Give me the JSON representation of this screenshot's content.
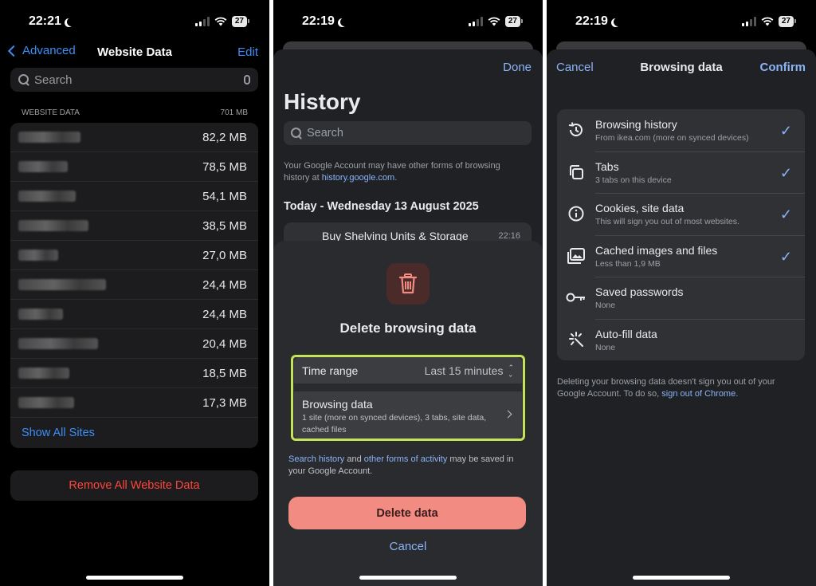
{
  "status": {
    "time1": "22:21",
    "time2": "22:19",
    "time3": "22:19",
    "battery": "27"
  },
  "panel1": {
    "back_label": "Advanced",
    "title": "Website Data",
    "edit_label": "Edit",
    "search_placeholder": "Search",
    "section_label": "WEBSITE DATA",
    "section_total": "701 MB",
    "rows": [
      {
        "size": "82,2 MB"
      },
      {
        "size": "78,5 MB"
      },
      {
        "size": "54,1 MB"
      },
      {
        "size": "38,5 MB"
      },
      {
        "size": "27,0 MB"
      },
      {
        "size": "24,4 MB"
      },
      {
        "size": "24,4 MB"
      },
      {
        "size": "20,4 MB"
      },
      {
        "size": "18,5 MB"
      },
      {
        "size": "17,3 MB"
      }
    ],
    "show_all": "Show All Sites",
    "remove_all": "Remove All Website Data"
  },
  "panel2": {
    "done_label": "Done",
    "title": "History",
    "search_placeholder": "Search",
    "note_text": "Your Google Account may have other forms of browsing history at ",
    "note_link": "history.google.com",
    "note_end": ".",
    "day_header": "Today - Wednesday 13 August 2025",
    "peek_title": "Buy Shelving Units & Storage",
    "peek_time": "22:16",
    "dialog_title": "Delete browsing data",
    "time_range_label": "Time range",
    "time_range_value": "Last 15 minutes",
    "browsing_data_label": "Browsing data",
    "browsing_data_sub": "1 site (more on synced devices), 3 tabs, site data, cached files",
    "save_link1": "Search history",
    "save_mid": " and ",
    "save_link2": "other forms of activity",
    "save_end": " may be saved in your Google Account.",
    "delete_button": "Delete data",
    "cancel_button": "Cancel"
  },
  "panel3": {
    "cancel_label": "Cancel",
    "title": "Browsing data",
    "confirm_label": "Confirm",
    "items": [
      {
        "title": "Browsing history",
        "sub": "From ikea.com (more on synced devices)",
        "checked": true,
        "icon": "history-icon"
      },
      {
        "title": "Tabs",
        "sub": "3 tabs on this device",
        "checked": true,
        "icon": "tabs-icon"
      },
      {
        "title": "Cookies, site data",
        "sub": "This will sign you out of most websites.",
        "checked": true,
        "icon": "info-icon"
      },
      {
        "title": "Cached images and files",
        "sub": "Less than 1,9 MB",
        "checked": true,
        "icon": "image-icon"
      },
      {
        "title": "Saved passwords",
        "sub": "None",
        "checked": false,
        "icon": "key-icon"
      },
      {
        "title": "Auto-fill data",
        "sub": "None",
        "checked": false,
        "icon": "autofill-icon"
      }
    ],
    "check_glyph": "✓",
    "footer_text": "Deleting your browsing data doesn't sign you out of your Google Account. To do so, ",
    "footer_link": "sign out of Chrome",
    "footer_end": "."
  }
}
